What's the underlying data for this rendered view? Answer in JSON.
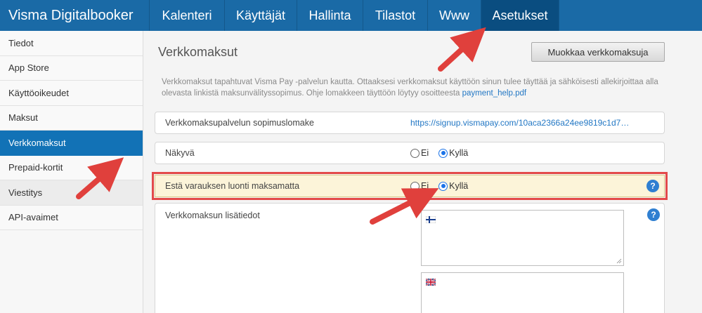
{
  "app": {
    "brand": "Visma Digitalbooker"
  },
  "topnav": {
    "items": [
      {
        "label": "Kalenteri",
        "active": false
      },
      {
        "label": "Käyttäjät",
        "active": false
      },
      {
        "label": "Hallinta",
        "active": false
      },
      {
        "label": "Tilastot",
        "active": false
      },
      {
        "label": "Www",
        "active": false
      },
      {
        "label": "Asetukset",
        "active": true
      }
    ]
  },
  "sidebar": {
    "items": [
      {
        "label": "Tiedot"
      },
      {
        "label": "App Store"
      },
      {
        "label": "Käyttöoikeudet"
      },
      {
        "label": "Maksut"
      },
      {
        "label": "Verkkomaksut",
        "active": true
      },
      {
        "label": "Prepaid-kortit"
      },
      {
        "label": "Viestitys"
      },
      {
        "label": "API-avaimet"
      }
    ]
  },
  "main": {
    "title": "Verkkomaksut",
    "edit_button": "Muokkaa verkkomaksuja",
    "description_text": "Verkkomaksut tapahtuvat Visma Pay -palvelun kautta. Ottaaksesi verkkomaksut käyttöön sinun tulee täyttää ja sähköisesti allekirjoittaa alla olevasta linkistä maksunvälityssopimus. Ohje lomakkeen täyttöön löytyy osoitteesta ",
    "description_link": "payment_help.pdf",
    "rows": {
      "contract": {
        "label": "Verkkomaksupalvelun sopimuslomake",
        "link": "https://signup.vismapay.com/10aca2366a24ee9819c1d7…"
      },
      "visible": {
        "label": "Näkyvä",
        "options": [
          "Ei",
          "Kyllä"
        ],
        "selected": "Kyllä"
      },
      "prevent": {
        "label": "Estä varauksen luonti maksamatta",
        "options": [
          "Ei",
          "Kyllä"
        ],
        "selected": "Kyllä"
      },
      "extra_info": {
        "label": "Verkkomaksun lisätiedot"
      }
    },
    "help_icon": "?"
  },
  "colors": {
    "nav_bg": "#1a6aa6",
    "nav_active": "#0a4d80",
    "sidebar_active": "#1272b6",
    "highlight_bg": "#fcf4d9",
    "highlight_border": "#e34a4a",
    "annotation_arrow": "#e0403c"
  }
}
